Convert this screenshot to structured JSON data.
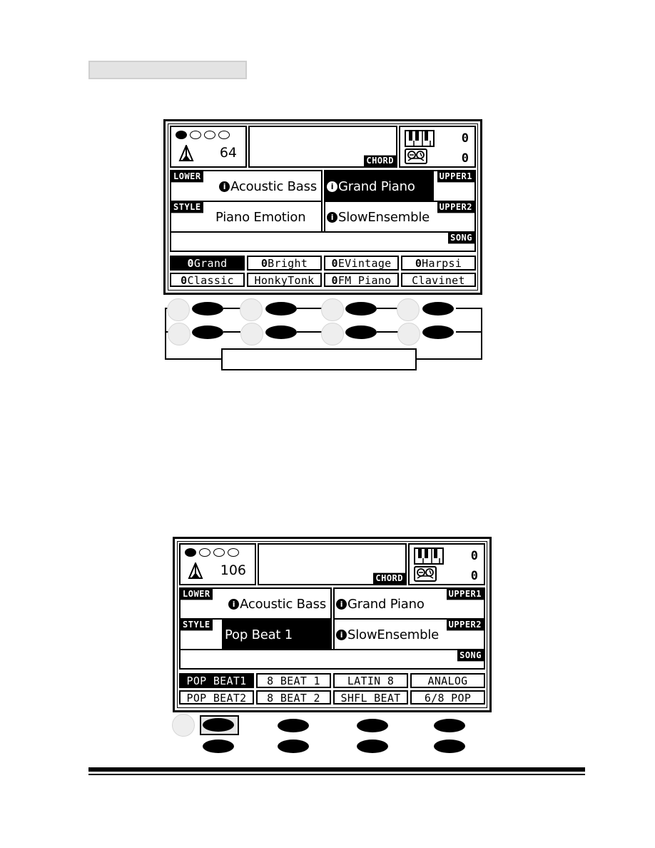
{
  "section_header": {
    "label": ""
  },
  "display1": {
    "beat_indicator": {
      "total": 4,
      "active": 1
    },
    "tempo": "64",
    "chord_label": "CHORD",
    "keyboard_value": "0",
    "tape_value": "0",
    "lower": {
      "tag": "LOWER",
      "voice": "Acoustic Bass",
      "info_icon": "i"
    },
    "upper1": {
      "tag": "UPPER1",
      "voice": "Grand Piano",
      "info_icon": "i",
      "selected": true
    },
    "style": {
      "tag": "STYLE",
      "name": "Piano Emotion",
      "selected": false
    },
    "upper2": {
      "tag": "UPPER2",
      "voice": "SlowEnsemble",
      "info_icon": "i"
    },
    "song_label": "SONG",
    "menu": [
      {
        "label": "Grand",
        "prefix": "0",
        "selected": true
      },
      {
        "label": "Bright",
        "prefix": "0",
        "selected": false
      },
      {
        "label": "EVintage",
        "prefix": "0",
        "selected": false
      },
      {
        "label": "Harpsi",
        "prefix": "0",
        "selected": false
      },
      {
        "label": "Classic",
        "prefix": "0",
        "selected": false
      },
      {
        "label": "HonkyTonk",
        "prefix": "",
        "selected": false
      },
      {
        "label": "FM Piano",
        "prefix": "0",
        "selected": false
      },
      {
        "label": "Clavinet",
        "prefix": "",
        "selected": false
      }
    ]
  },
  "display2": {
    "beat_indicator": {
      "total": 4,
      "active": 1
    },
    "tempo": "106",
    "chord_label": "CHORD",
    "keyboard_value": "0",
    "tape_value": "0",
    "lower": {
      "tag": "LOWER",
      "voice": "Acoustic Bass",
      "info_icon": "i"
    },
    "upper1": {
      "tag": "UPPER1",
      "voice": "Grand Piano",
      "info_icon": "i",
      "selected": false
    },
    "style": {
      "tag": "STYLE",
      "name": "Pop Beat 1",
      "selected": true
    },
    "upper2": {
      "tag": "UPPER2",
      "voice": "SlowEnsemble",
      "info_icon": "i"
    },
    "song_label": "SONG",
    "menu": [
      {
        "label": "POP BEAT1",
        "selected": true
      },
      {
        "label": "8 BEAT 1",
        "selected": false
      },
      {
        "label": "LATIN 8",
        "selected": false
      },
      {
        "label": "ANALOG",
        "selected": false
      },
      {
        "label": "POP BEAT2",
        "selected": false
      },
      {
        "label": "8 BEAT 2",
        "selected": false
      },
      {
        "label": "SHFL BEAT",
        "selected": false
      },
      {
        "label": "6/8 POP",
        "selected": false
      }
    ]
  },
  "button_diagram1": {
    "caption": ""
  },
  "button_diagram2": {
    "highlighted_button": 1
  }
}
